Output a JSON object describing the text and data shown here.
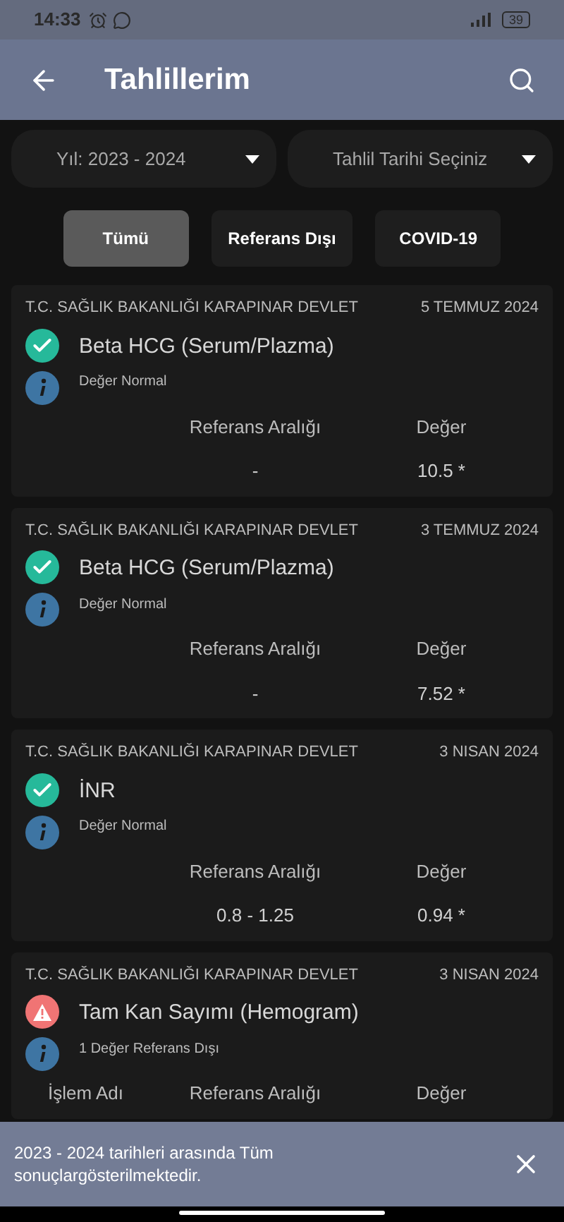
{
  "status_bar": {
    "time": "14:33",
    "battery": "39"
  },
  "app_bar": {
    "title": "Tahlillerim"
  },
  "filters": [
    {
      "label": "Yıl: 2023 - 2024"
    },
    {
      "label": "Tahlil Tarihi Seçiniz"
    }
  ],
  "tabs": [
    {
      "label": "Tümü",
      "selected": true
    },
    {
      "label": "Referans Dışı",
      "selected": false
    },
    {
      "label": "COVID-19",
      "selected": false
    }
  ],
  "results": [
    {
      "source": "T.C. SAĞLIK BAKANLIĞI KARAPINAR DEVLET",
      "date": "5 TEMMUZ 2024",
      "kind": "normal",
      "test": "Beta HCG (Serum/Plazma)",
      "summary": "Değer Normal",
      "columns": [
        "Referans Aralığı",
        "Değer"
      ],
      "values": [
        "-",
        "10.5 *"
      ]
    },
    {
      "source": "T.C. SAĞLIK BAKANLIĞI KARAPINAR DEVLET",
      "date": "3 TEMMUZ 2024",
      "kind": "normal",
      "test": "Beta HCG (Serum/Plazma)",
      "summary": "Değer Normal",
      "columns": [
        "Referans Aralığı",
        "Değer"
      ],
      "values": [
        "-",
        "7.52 *"
      ]
    },
    {
      "source": "T.C. SAĞLIK BAKANLIĞI KARAPINAR DEVLET",
      "date": "3 NISAN 2024",
      "kind": "normal",
      "test": "İNR",
      "summary": "Değer Normal",
      "columns": [
        "Referans Aralığı",
        "Değer"
      ],
      "values": [
        "0.8 - 1.25",
        "0.94 *"
      ]
    },
    {
      "source": "T.C. SAĞLIK BAKANLIĞI KARAPINAR DEVLET",
      "date": "3 NISAN 2024",
      "kind": "alert",
      "test": "Tam Kan Sayımı (Hemogram)",
      "summary": "1 Değer Referans Dışı",
      "columns": [
        "İşlem Adı",
        "Referans Aralığı",
        "Değer"
      ]
    }
  ],
  "snackbar": {
    "message": "2023 - 2024 tarihleri arasında Tüm sonuçlargösterilmektedir."
  }
}
